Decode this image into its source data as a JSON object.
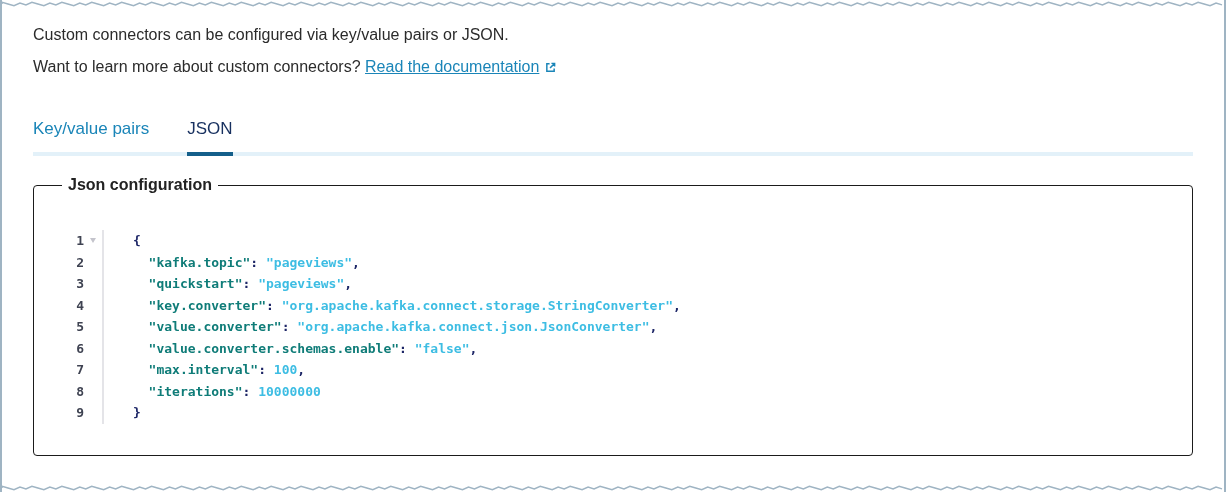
{
  "intro": "Custom connectors can be configured via key/value pairs or JSON.",
  "learn_more": {
    "text": "Want to learn more about custom connectors?",
    "link": "Read the documentation"
  },
  "tabs": [
    {
      "label": "Key/value pairs",
      "selected": false
    },
    {
      "label": "JSON",
      "selected": true
    }
  ],
  "editor": {
    "legend": "Json configuration",
    "lines": [
      {
        "number": "1",
        "indented": false,
        "foldable": true,
        "tokens": [
          {
            "kind": "punct",
            "text": "{"
          }
        ]
      },
      {
        "number": "2",
        "indented": true,
        "foldable": false,
        "tokens": [
          {
            "kind": "key",
            "text": "\"kafka.topic\""
          },
          {
            "kind": "punct",
            "text": ": "
          },
          {
            "kind": "string",
            "text": "\"pageviews\""
          },
          {
            "kind": "punct",
            "text": ","
          }
        ]
      },
      {
        "number": "3",
        "indented": true,
        "foldable": false,
        "tokens": [
          {
            "kind": "key",
            "text": "\"quickstart\""
          },
          {
            "kind": "punct",
            "text": ": "
          },
          {
            "kind": "string",
            "text": "\"pageviews\""
          },
          {
            "kind": "punct",
            "text": ","
          }
        ]
      },
      {
        "number": "4",
        "indented": true,
        "foldable": false,
        "tokens": [
          {
            "kind": "key",
            "text": "\"key.converter\""
          },
          {
            "kind": "punct",
            "text": ": "
          },
          {
            "kind": "string",
            "text": "\"org.apache.kafka.connect.storage.StringConverter\""
          },
          {
            "kind": "punct",
            "text": ","
          }
        ]
      },
      {
        "number": "5",
        "indented": true,
        "foldable": false,
        "tokens": [
          {
            "kind": "key",
            "text": "\"value.converter\""
          },
          {
            "kind": "punct",
            "text": ": "
          },
          {
            "kind": "string",
            "text": "\"org.apache.kafka.connect.json.JsonConverter\""
          },
          {
            "kind": "punct",
            "text": ","
          }
        ]
      },
      {
        "number": "6",
        "indented": true,
        "foldable": false,
        "tokens": [
          {
            "kind": "key",
            "text": "\"value.converter.schemas.enable\""
          },
          {
            "kind": "punct",
            "text": ": "
          },
          {
            "kind": "string",
            "text": "\"false\""
          },
          {
            "kind": "punct",
            "text": ","
          }
        ]
      },
      {
        "number": "7",
        "indented": true,
        "foldable": false,
        "tokens": [
          {
            "kind": "key",
            "text": "\"max.interval\""
          },
          {
            "kind": "punct",
            "text": ": "
          },
          {
            "kind": "number",
            "text": "100"
          },
          {
            "kind": "punct",
            "text": ","
          }
        ]
      },
      {
        "number": "8",
        "indented": true,
        "foldable": false,
        "tokens": [
          {
            "kind": "key",
            "text": "\"iterations\""
          },
          {
            "kind": "punct",
            "text": ": "
          },
          {
            "kind": "number",
            "text": "10000000"
          }
        ]
      },
      {
        "number": "9",
        "indented": false,
        "foldable": false,
        "tokens": [
          {
            "kind": "punct",
            "text": "}"
          }
        ]
      }
    ]
  }
}
